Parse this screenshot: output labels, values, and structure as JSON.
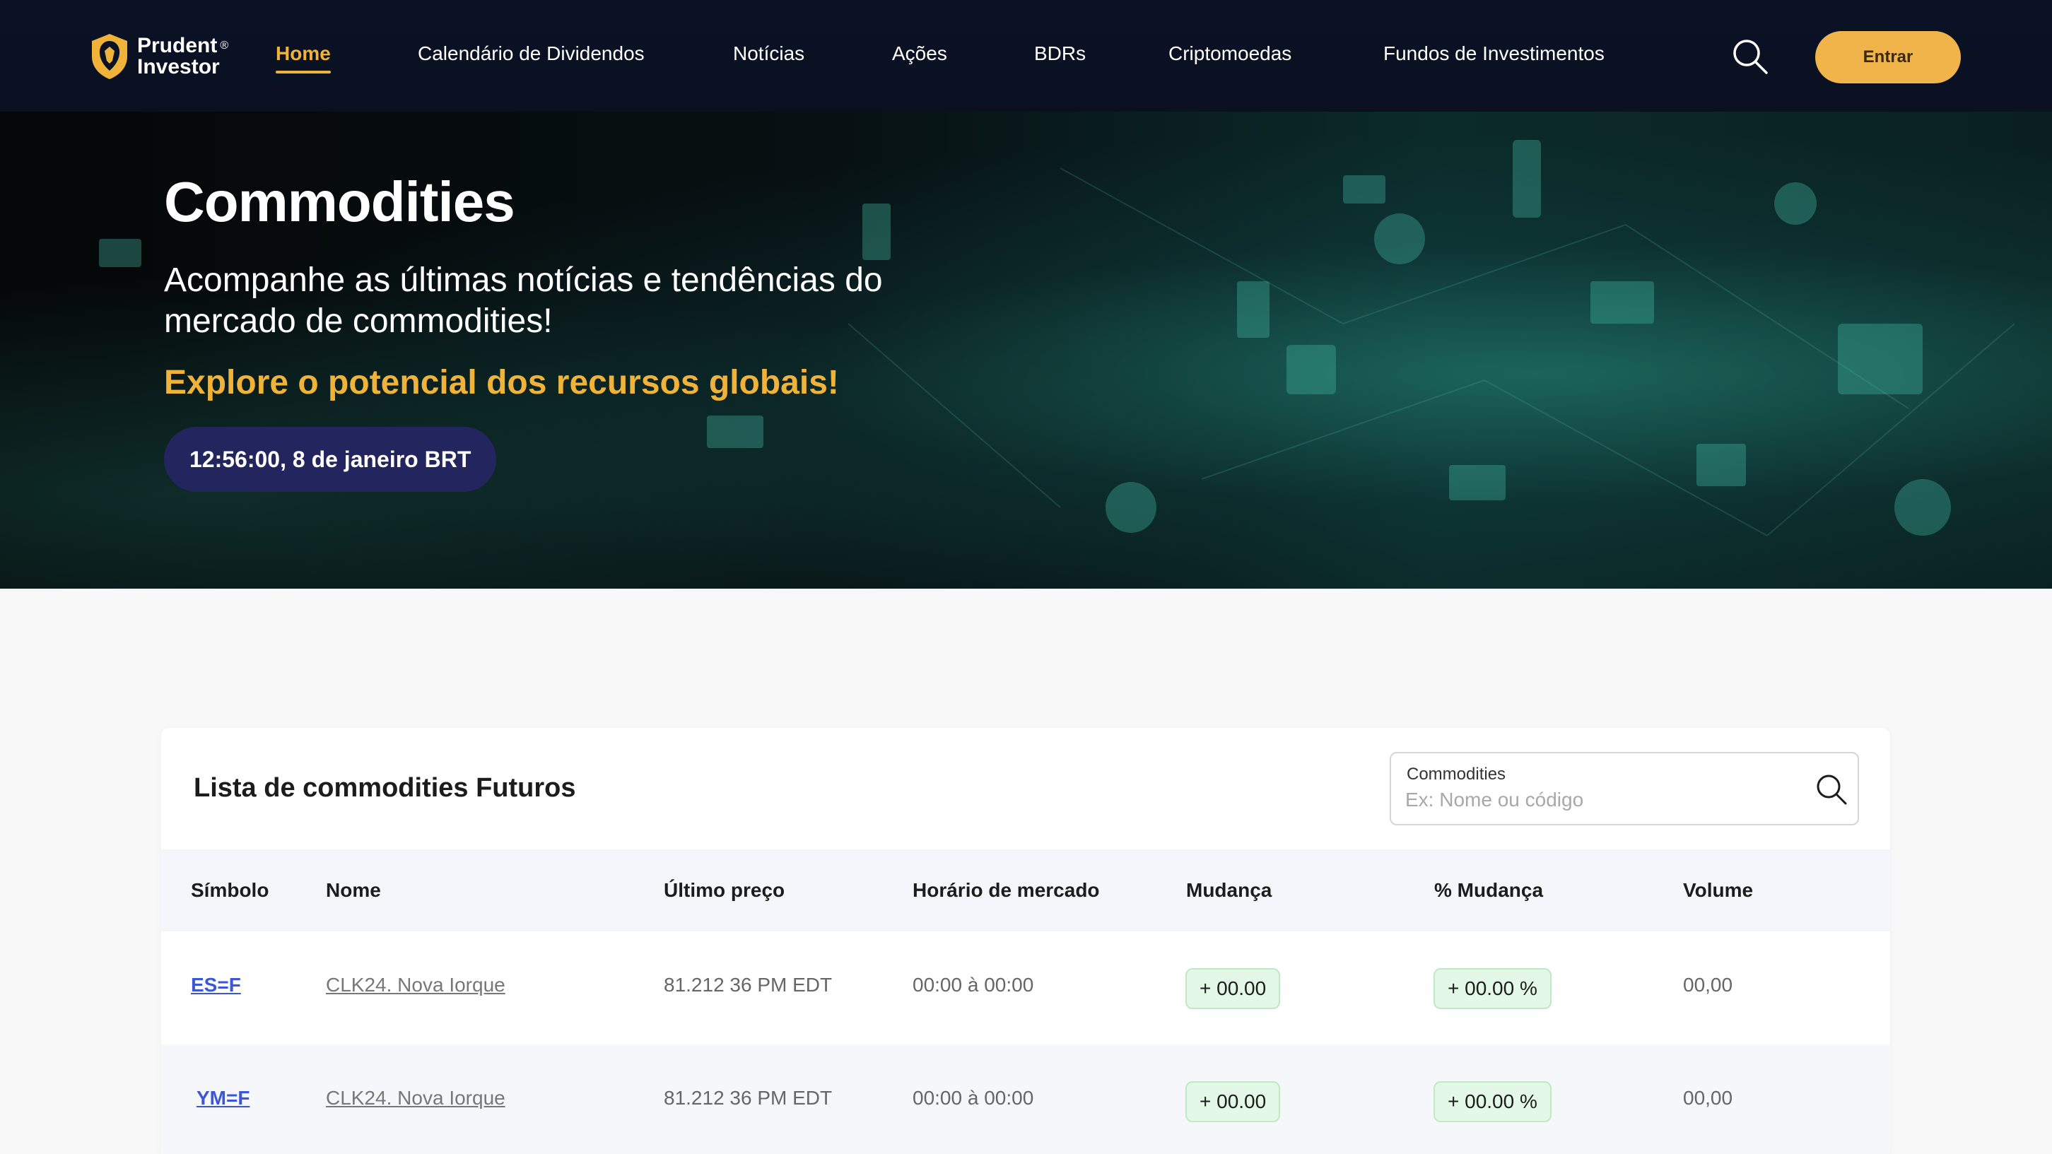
{
  "brand": {
    "line1": "Prudent",
    "line2": "Investor",
    "reg": "®"
  },
  "nav": {
    "items": [
      {
        "label": "Home",
        "active": true
      },
      {
        "label": "Calendário de Dividendos"
      },
      {
        "label": "Notícias"
      },
      {
        "label": "Ações"
      },
      {
        "label": "BDRs"
      },
      {
        "label": "Criptomoedas"
      },
      {
        "label": "Fundos de Investimentos"
      }
    ],
    "search_icon": "search-icon",
    "enter_label": "Entrar"
  },
  "hero": {
    "title": "Commodities",
    "subtitle": "Acompanhe as últimas notícias e tendências do mercado de commodities!",
    "tagline": "Explore o potencial dos recursos globais!",
    "time": "12:56:00, 8 de janeiro BRT"
  },
  "list": {
    "title": "Lista de commodities Futuros",
    "filter_label": "Commodities",
    "filter_placeholder": "Ex: Nome ou código",
    "filter_value": "",
    "columns": [
      "Símbolo",
      "Nome",
      "Último preço",
      "Horário de mercado",
      "Mudança",
      "% Mudança",
      "Volume"
    ],
    "rows": [
      {
        "symbol": "ES=F",
        "name": "CLK24. Nova Iorque",
        "price": "81.212 36 PM EDT",
        "hours": "00:00 à 00:00",
        "change": "+ 00.00",
        "pct": "+ 00.00 %",
        "volume": "00,00"
      },
      {
        "symbol": "YM=F",
        "name": "CLK24. Nova Iorque",
        "price": "81.212 36 PM EDT",
        "hours": "00:00 à 00:00",
        "change": "+ 00.00",
        "pct": "+ 00.00 %",
        "volume": "00,00"
      }
    ]
  },
  "colors": {
    "accent": "#f0b33a",
    "header_bg": "#0b1226",
    "time_pill": "#23265e",
    "symbol_link": "#3c57d6",
    "positive_bg": "#e3f8e6"
  }
}
